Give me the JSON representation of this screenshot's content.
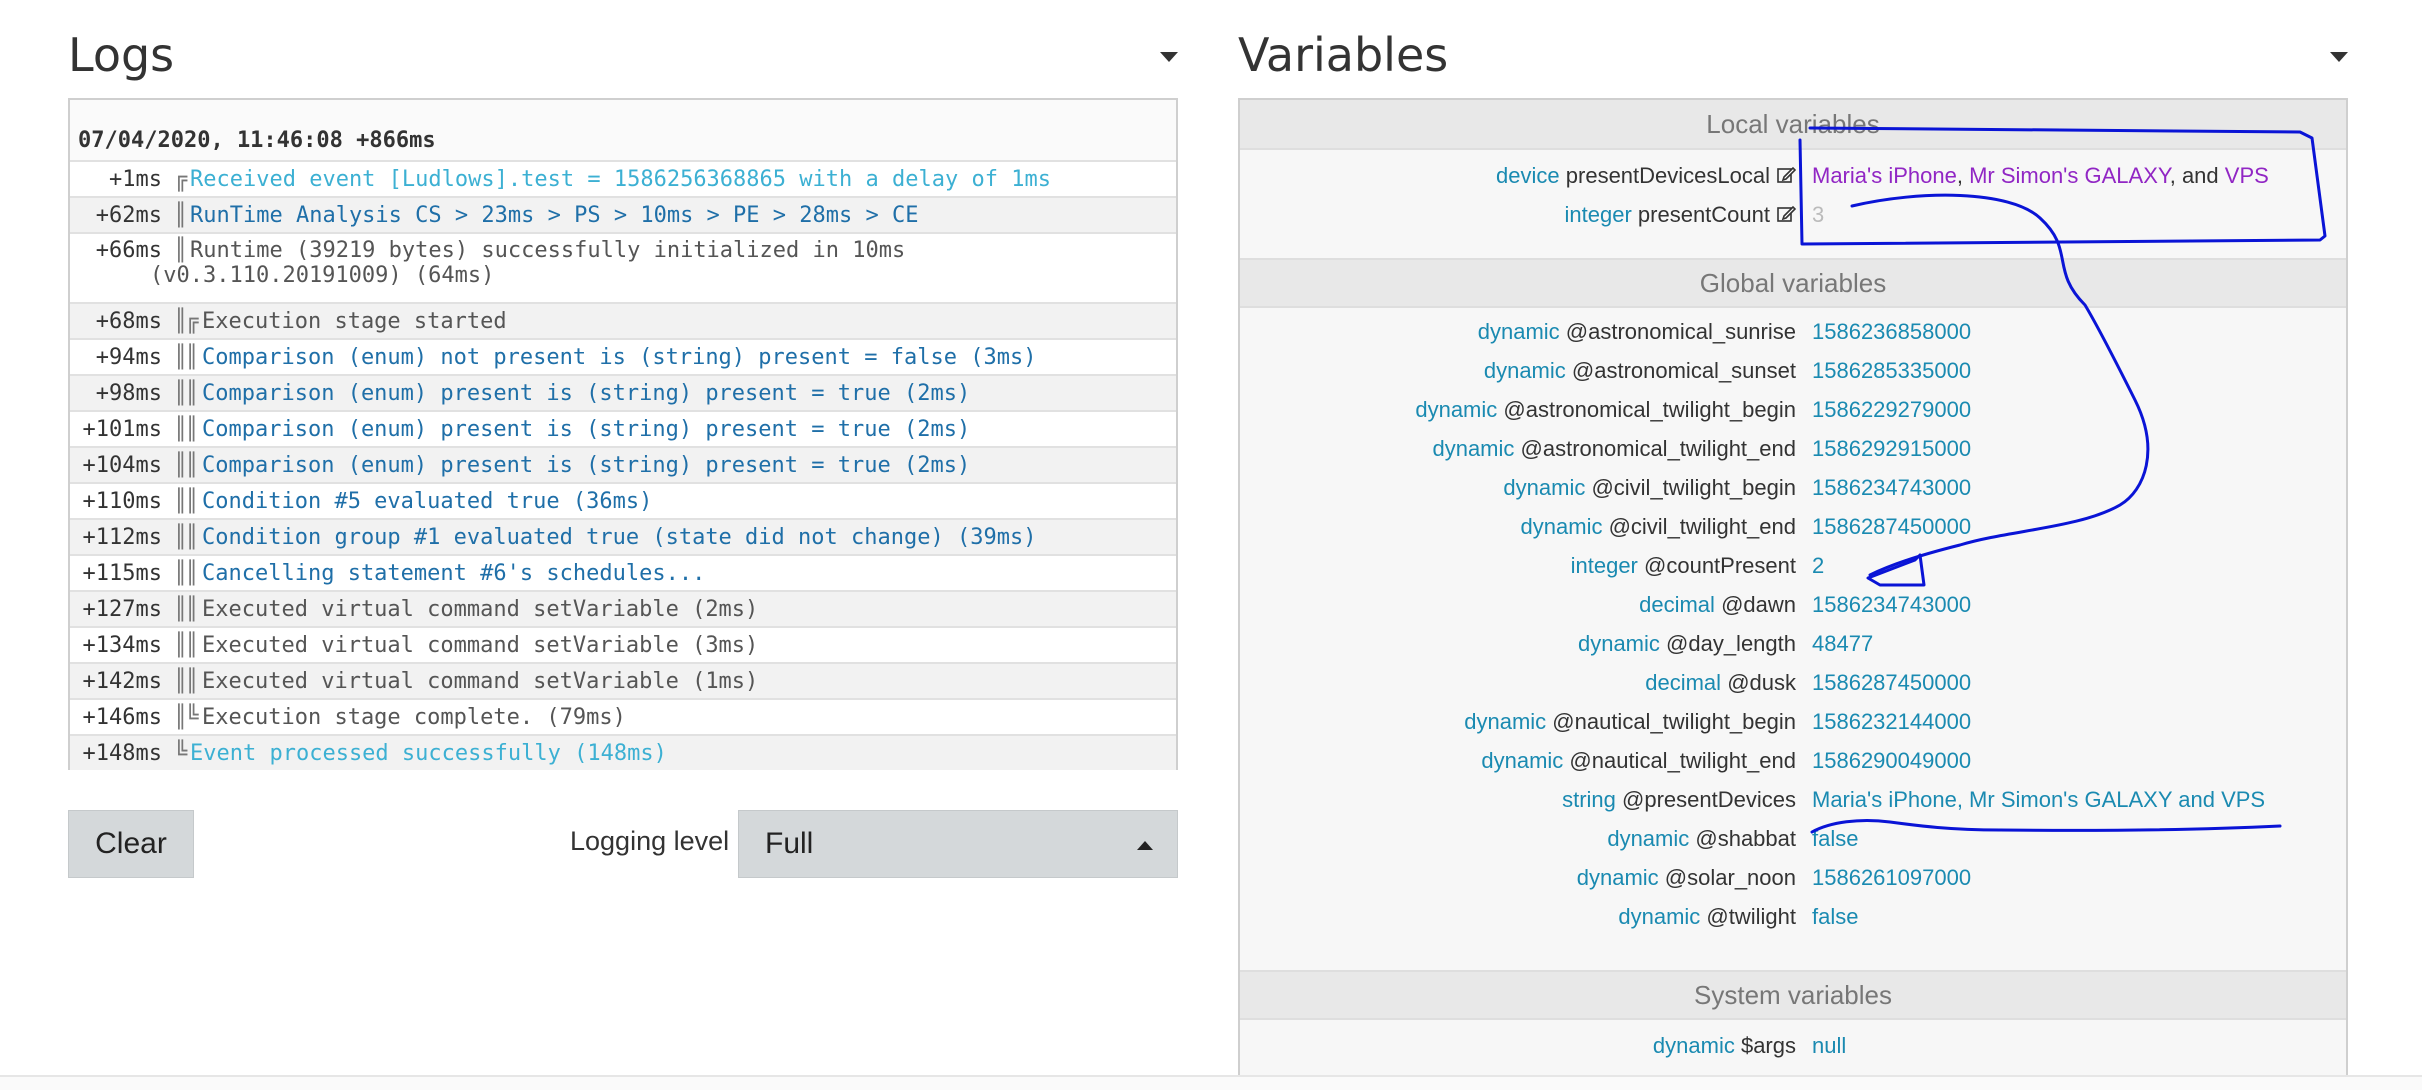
{
  "logs": {
    "title": "Logs",
    "date": "07/04/2020, 11:46:08 +866ms",
    "entries": [
      {
        "time": "+1ms",
        "bar": "╔",
        "msg": "Received event [Ludlows].test = 1586256368865 with a delay of 1ms",
        "style": "cyan"
      },
      {
        "time": "+62ms",
        "bar": "║",
        "msg": "RunTime Analysis CS > 23ms > PS > 10ms > PE > 28ms > CE",
        "style": "blue"
      },
      {
        "time": "+66ms",
        "bar": "║",
        "msg": "Runtime (39219 bytes) successfully initialized in 10ms",
        "msg2": "(v0.3.110.20191009) (64ms)",
        "style": "gray"
      },
      {
        "time": "+68ms",
        "bar": "║╔",
        "msg": "Execution stage started",
        "style": "gray"
      },
      {
        "time": "+94ms",
        "bar": "║║",
        "msg": "Comparison (enum) not present is (string) present = false (3ms)",
        "style": "blue"
      },
      {
        "time": "+98ms",
        "bar": "║║",
        "msg": "Comparison (enum) present is (string) present = true (2ms)",
        "style": "blue"
      },
      {
        "time": "+101ms",
        "bar": "║║",
        "msg": "Comparison (enum) present is (string) present = true (2ms)",
        "style": "blue"
      },
      {
        "time": "+104ms",
        "bar": "║║",
        "msg": "Comparison (enum) present is (string) present = true (2ms)",
        "style": "blue"
      },
      {
        "time": "+110ms",
        "bar": "║║",
        "msg": "Condition #5 evaluated true (36ms)",
        "style": "blue"
      },
      {
        "time": "+112ms",
        "bar": "║║",
        "msg": "Condition group #1 evaluated true (state did not change) (39ms)",
        "style": "blue"
      },
      {
        "time": "+115ms",
        "bar": "║║",
        "msg": "Cancelling statement #6's schedules...",
        "style": "blue"
      },
      {
        "time": "+127ms",
        "bar": "║║",
        "msg": "Executed virtual command setVariable (2ms)",
        "style": "gray"
      },
      {
        "time": "+134ms",
        "bar": "║║",
        "msg": "Executed virtual command setVariable (3ms)",
        "style": "gray"
      },
      {
        "time": "+142ms",
        "bar": "║║",
        "msg": "Executed virtual command setVariable (1ms)",
        "style": "gray"
      },
      {
        "time": "+146ms",
        "bar": "║╚",
        "msg": "Execution stage complete. (79ms)",
        "style": "gray"
      },
      {
        "time": "+148ms",
        "bar": "╚",
        "msg": "Event processed successfully (148ms)",
        "style": "cyan"
      }
    ],
    "clear_label": "Clear",
    "level_label": "Logging level",
    "level_value": "Full"
  },
  "variables": {
    "title": "Variables",
    "local_header": "Local variables",
    "global_header": "Global variables",
    "system_header": "System variables",
    "local": [
      {
        "type": "device",
        "name": "presentDevicesLocal",
        "editable": true,
        "parts": [
          {
            "t": "Maria's iPhone",
            "c": "purple"
          },
          {
            "t": ", ",
            "c": "dark"
          },
          {
            "t": "Mr Simon's GALAXY",
            "c": "purple"
          },
          {
            "t": ", and ",
            "c": "dark"
          },
          {
            "t": "VPS",
            "c": "purple"
          }
        ]
      },
      {
        "type": "integer",
        "name": "presentCount",
        "editable": true,
        "value": "3",
        "faint": true
      }
    ],
    "global": [
      {
        "type": "dynamic",
        "name": "@astronomical_sunrise",
        "value": "1586236858000"
      },
      {
        "type": "dynamic",
        "name": "@astronomical_sunset",
        "value": "1586285335000"
      },
      {
        "type": "dynamic",
        "name": "@astronomical_twilight_begin",
        "value": "1586229279000"
      },
      {
        "type": "dynamic",
        "name": "@astronomical_twilight_end",
        "value": "1586292915000"
      },
      {
        "type": "dynamic",
        "name": "@civil_twilight_begin",
        "value": "1586234743000"
      },
      {
        "type": "dynamic",
        "name": "@civil_twilight_end",
        "value": "1586287450000"
      },
      {
        "type": "integer",
        "name": "@countPresent",
        "value": "2"
      },
      {
        "type": "decimal",
        "name": "@dawn",
        "value": "1586234743000"
      },
      {
        "type": "dynamic",
        "name": "@day_length",
        "value": "48477"
      },
      {
        "type": "decimal",
        "name": "@dusk",
        "value": "1586287450000"
      },
      {
        "type": "dynamic",
        "name": "@nautical_twilight_begin",
        "value": "1586232144000"
      },
      {
        "type": "dynamic",
        "name": "@nautical_twilight_end",
        "value": "1586290049000"
      },
      {
        "type": "string",
        "name": "@presentDevices",
        "value": "Maria's iPhone, Mr Simon's GALAXY and VPS"
      },
      {
        "type": "dynamic",
        "name": "@shabbat",
        "value": "false"
      },
      {
        "type": "dynamic",
        "name": "@solar_noon",
        "value": "1586261097000"
      },
      {
        "type": "dynamic",
        "name": "@twilight",
        "value": "false"
      }
    ],
    "system": [
      {
        "type": "dynamic",
        "name": "$args",
        "value": "null"
      }
    ]
  },
  "colors": {
    "type": "#1a8ab1",
    "device_value": "#9126c4",
    "log_cyan": "#3cb0d3",
    "log_blue": "#1f6fa8",
    "annotation": "#0a14d6"
  },
  "icons": {
    "edit": "edit-icon",
    "caret_down": "chevron-down-icon",
    "caret_up": "chevron-up-icon"
  }
}
